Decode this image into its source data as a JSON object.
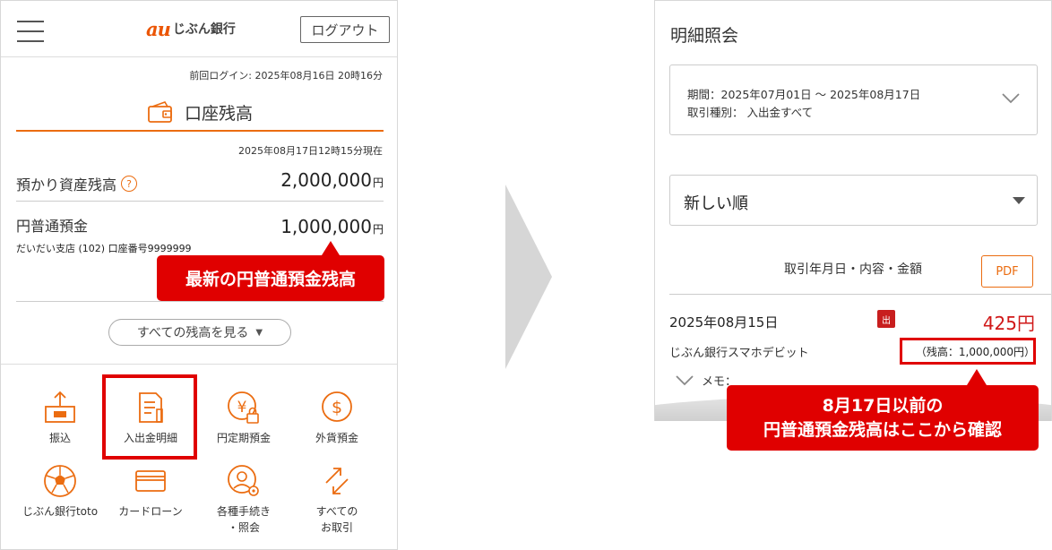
{
  "left": {
    "logo_mark": "au",
    "logo_text": "じぶん銀行",
    "logout_label": "ログアウト",
    "last_login": "前回ログイン: 2025年08月16日 20時16分",
    "balance_title": "口座残高",
    "as_of": "2025年08月17日12時15分現在",
    "asset_label": "預かり資産残高",
    "asset_amount": "2,000,000",
    "deposit_label": "円普通預金",
    "deposit_amount": "1,000,000",
    "currency_unit": "円",
    "branch_info": "だいだい支店 (102) 口座番号9999999",
    "callout": "最新の円普通預金残高",
    "see_all_label": "すべての残高を見る",
    "menu": [
      {
        "label": "振込",
        "icon": "transfer-icon"
      },
      {
        "label": "入出金明細",
        "icon": "statement-icon"
      },
      {
        "label": "円定期預金",
        "icon": "yen-lock-icon"
      },
      {
        "label": "外貨預金",
        "icon": "dollar-icon"
      },
      {
        "label": "じぶん銀行toto",
        "icon": "soccer-ball-icon"
      },
      {
        "label": "カードローン",
        "icon": "card-icon"
      },
      {
        "label": "各種手続き\n・照会",
        "icon": "person-gear-icon"
      },
      {
        "label": "すべての\nお取引",
        "icon": "arrows-icon"
      }
    ]
  },
  "right": {
    "title": "明細照会",
    "filter_period": "期間：2025年07月01日 〜 2025年08月17日",
    "filter_type": "取引種別： 入出金すべて",
    "sort_value": "新しい順",
    "column_header": "取引年月日・内容・金額",
    "pdf_label": "PDF",
    "txn": {
      "date": "2025年08月15日",
      "badge": "出",
      "amount": "425円",
      "name": "じぶん銀行スマホデビット",
      "balance": "（残高：1,000,000円）",
      "memo": "メモ："
    },
    "callout_line1": "8月17日以前の",
    "callout_line2": "円普通預金残高はここから確認"
  },
  "colors": {
    "accent": "#eb6c10",
    "callout": "#e00000",
    "debit": "#d01818"
  }
}
